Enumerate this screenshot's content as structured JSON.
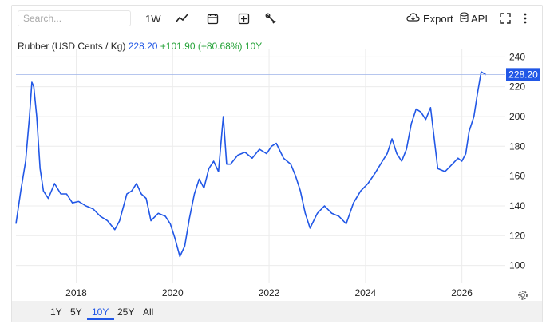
{
  "toolbar": {
    "search_placeholder": "Search...",
    "interval": "1W",
    "line_icon": "line-chart-icon",
    "calendar_icon": "calendar-icon",
    "add_icon": "plus-square-icon",
    "wrench_icon": "wrench-icon",
    "export_label": "Export",
    "api_label": "API",
    "fullscreen_icon": "fullscreen-icon",
    "more_icon": "more-vertical-icon"
  },
  "legend": {
    "name": "Rubber (USD Cents / Kg)",
    "value": "228.20",
    "change": "+101.90 (+80.68%)",
    "period": "10Y"
  },
  "ranges": [
    "1Y",
    "5Y",
    "10Y",
    "25Y",
    "All"
  ],
  "active_range": "10Y",
  "colors": {
    "line": "#2157e6",
    "up": "#27a33a",
    "grid": "#ececec"
  },
  "chart_data": {
    "type": "line",
    "title": "Rubber (USD Cents / Kg)",
    "xlabel": "",
    "ylabel": "",
    "xlim": [
      2016.75,
      2026.9
    ],
    "ylim": [
      88,
      245
    ],
    "y_ticks": [
      "100",
      "120",
      "140",
      "160",
      "180",
      "200",
      "220",
      "240"
    ],
    "x_ticks": [
      "2018",
      "2020",
      "2022",
      "2024",
      "2026"
    ],
    "last_price": "228.20",
    "series": [
      {
        "x": [
          2016.75,
          2016.85,
          2016.95,
          2017.03,
          2017.08,
          2017.12,
          2017.18,
          2017.25,
          2017.32,
          2017.42,
          2017.55,
          2017.68,
          2017.8,
          2017.92,
          2018.05,
          2018.2,
          2018.35,
          2018.5,
          2018.65,
          2018.8,
          2018.9,
          2019.05,
          2019.15,
          2019.25,
          2019.35,
          2019.45,
          2019.55,
          2019.7,
          2019.85,
          2019.95,
          2020.05,
          2020.15,
          2020.25,
          2020.35,
          2020.45,
          2020.55,
          2020.65,
          2020.75,
          2020.85,
          2020.95,
          2021.05,
          2021.12,
          2021.2,
          2021.35,
          2021.5,
          2021.65,
          2021.8,
          2021.95,
          2022.05,
          2022.15,
          2022.3,
          2022.45,
          2022.55,
          2022.65,
          2022.75,
          2022.85,
          2023.0,
          2023.15,
          2023.3,
          2023.45,
          2023.6,
          2023.75,
          2023.9,
          2024.05,
          2024.2,
          2024.35,
          2024.45,
          2024.55,
          2024.65,
          2024.75,
          2024.85,
          2024.95,
          2025.05,
          2025.15,
          2025.25,
          2025.35,
          2025.5,
          2025.65,
          2025.8,
          2025.92,
          2026.0,
          2026.08,
          2026.15,
          2026.25,
          2026.32,
          2026.4,
          2026.5
        ],
        "y": [
          128,
          150,
          170,
          200,
          223,
          220,
          200,
          165,
          150,
          145,
          155,
          148,
          148,
          142,
          143,
          140,
          138,
          133,
          130,
          124,
          130,
          148,
          150,
          155,
          148,
          145,
          130,
          135,
          133,
          128,
          118,
          106,
          113,
          132,
          148,
          158,
          152,
          165,
          170,
          163,
          200,
          168,
          168,
          174,
          176,
          172,
          178,
          175,
          180,
          182,
          172,
          168,
          160,
          150,
          135,
          125,
          135,
          140,
          135,
          133,
          128,
          142,
          150,
          155,
          162,
          170,
          175,
          185,
          175,
          170,
          178,
          195,
          205,
          203,
          198,
          206,
          165,
          163,
          168,
          172,
          170,
          175,
          190,
          200,
          215,
          230,
          228
        ]
      }
    ]
  }
}
